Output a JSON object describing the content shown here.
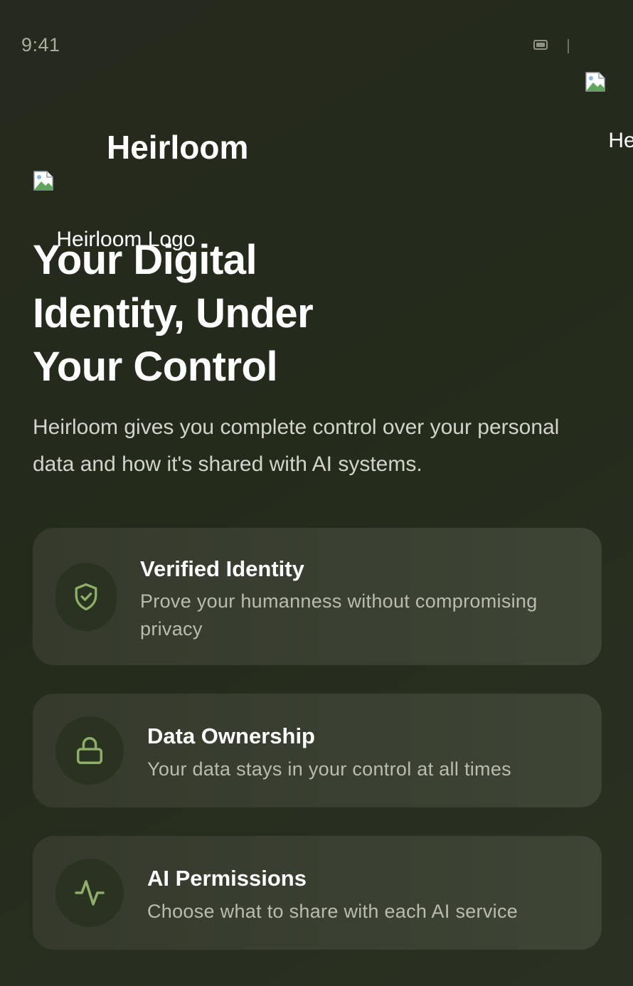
{
  "status_bar": {
    "time": "9:41"
  },
  "top_logo": {
    "alt": "Heirloom Logo"
  },
  "brand": {
    "logo_alt": "Heirloom Logo",
    "name": "Heirloom"
  },
  "hero": {
    "title": "Your Digital Identity, Under Your Control",
    "subtitle": "Heirloom gives you complete control over your personal data and how it's shared with AI systems."
  },
  "features": [
    {
      "icon": "shield-check-icon",
      "title": "Verified Identity",
      "description": "Prove your humanness without compromising privacy"
    },
    {
      "icon": "lock-icon",
      "title": "Data Ownership",
      "description": "Your data stays in your control at all times"
    },
    {
      "icon": "activity-icon",
      "title": "AI Permissions",
      "description": "Choose what to share with each AI service"
    }
  ],
  "colors": {
    "background": "#23291a",
    "card": "#3a4030",
    "icon_circle": "#2a3320",
    "icon_stroke": "#8fae6a",
    "text_primary": "#ffffff",
    "text_secondary": "#b9bcb0"
  }
}
